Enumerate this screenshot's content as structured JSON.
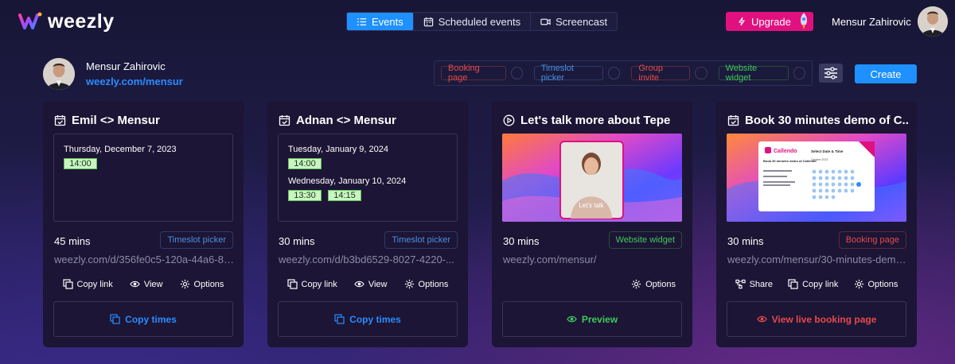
{
  "brand": {
    "name": "weezly"
  },
  "nav": {
    "tabs": [
      {
        "label": "Events",
        "icon": "list-icon",
        "active": true
      },
      {
        "label": "Scheduled events",
        "icon": "calendar-icon",
        "active": false
      },
      {
        "label": "Screencast",
        "icon": "video-icon",
        "active": false
      }
    ],
    "upgrade_label": "Upgrade",
    "user_name": "Mensur Zahirovic"
  },
  "profile": {
    "name": "Mensur Zahirovic",
    "link": "weezly.com/mensur"
  },
  "filters": [
    {
      "label": "Booking page",
      "color": "#e54a4a"
    },
    {
      "label": "Timeslot picker",
      "color": "#4a90e2"
    },
    {
      "label": "Group invite",
      "color": "#e54a4a"
    },
    {
      "label": "Website widget",
      "color": "#3fc95c"
    }
  ],
  "create_label": "Create",
  "cards": [
    {
      "title": "Emil <> Mensur",
      "icon": "calendar-check-icon",
      "dates": [
        {
          "label": "Thursday, December 7, 2023",
          "times": [
            "14:00"
          ]
        }
      ],
      "duration": "45 mins",
      "tag": "Timeslot picker",
      "url": "weezly.com/d/356fe0c5-120a-44a6-8f...",
      "actions": [
        "Copy link",
        "View",
        "Options"
      ],
      "bottom": "Copy times"
    },
    {
      "title": "Adnan <> Mensur",
      "icon": "calendar-check-icon",
      "dates": [
        {
          "label": "Tuesday, January 9, 2024",
          "times": [
            "14:00"
          ]
        },
        {
          "label": "Wednesday, January 10, 2024",
          "times": [
            "13:30",
            "14:15"
          ]
        }
      ],
      "duration": "30 mins",
      "tag": "Timeslot picker",
      "url": "weezly.com/d/b3bd6529-8027-4220-...",
      "actions": [
        "Copy link",
        "View",
        "Options"
      ],
      "bottom": "Copy times"
    },
    {
      "title": "Let's talk more about Tepe",
      "icon": "play-circle-icon",
      "media_caption": "Let's talk",
      "duration": "30 mins",
      "tag": "Website widget",
      "url": "weezly.com/mensur/",
      "actions": [
        "Options"
      ],
      "bottom": "Preview"
    },
    {
      "title": "Book 30 minutes demo of C...",
      "icon": "calendar-check-icon",
      "preview": {
        "brand": "Callendo",
        "heading": "Select Date & Time",
        "event": "Book 30 minutes demo of Callendo",
        "month": "October 2023"
      },
      "duration": "30 mins",
      "tag": "Booking page",
      "url": "weezly.com/mensur/30-minutes-demo...",
      "actions": [
        "Share",
        "Copy link",
        "Options"
      ],
      "bottom": "View live booking page"
    }
  ]
}
